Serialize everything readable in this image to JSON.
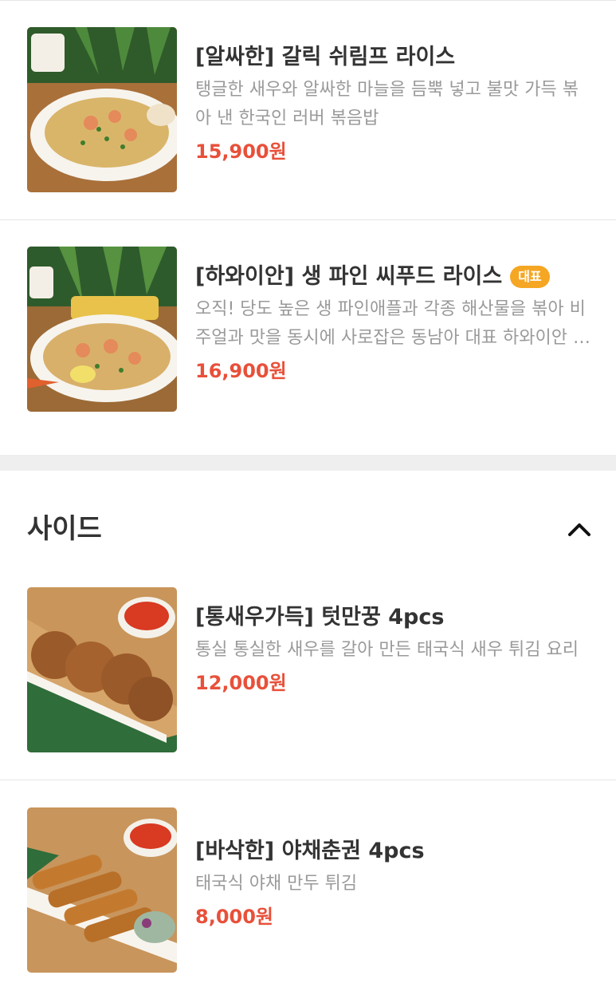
{
  "colors": {
    "price": "#e8503a",
    "badge": "#f5a623",
    "section_gap": "#efefef"
  },
  "items_top": [
    {
      "title": "[알싸한] 갈릭 쉬림프 라이스",
      "description": "탱글한 새우와 알싸한 마늘을 듬뿍 넣고 불맛 가득 볶아 낸 한국인 러버 볶음밥",
      "price": "15,900원",
      "image": "garlic-shrimp-rice-photo"
    },
    {
      "title": "[하와이안] 생 파인 씨푸드 라이스",
      "badge": "대표",
      "description": "오직! 당도 높은 생 파인애플과 각종 해산물을 볶아 비주얼과 맛을 동시에 사로잡은 동남아 대표 하와이안 볶음밥",
      "price": "16,900원",
      "image": "pineapple-seafood-rice-photo"
    }
  ],
  "side_section": {
    "title": "사이드",
    "toggle_icon": "chevron-up-icon",
    "items": [
      {
        "title": "[통새우가득] 텃만꿍 4pcs",
        "description": "통실 통실한 새우를 갈아 만든 태국식 새우 튀김 요리",
        "price": "12,000원",
        "image": "shrimp-cake-photo"
      },
      {
        "title": "[바삭한] 야채춘권 4pcs",
        "description": "태국식 야채 만두 튀김",
        "price": "8,000원",
        "image": "spring-roll-photo"
      }
    ]
  }
}
